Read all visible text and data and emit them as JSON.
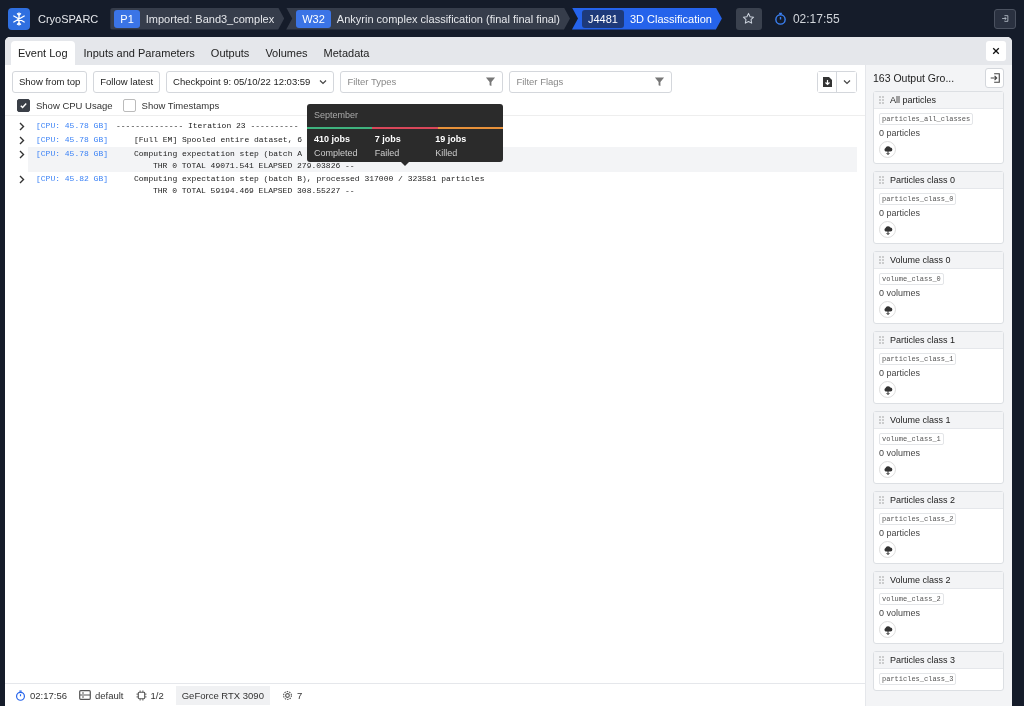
{
  "topbar": {
    "app_name": "CryoSPARC",
    "breadcrumbs": [
      {
        "badge": "P1",
        "label": "Imported: Band3_complex",
        "selected": false
      },
      {
        "badge": "W32",
        "label": "Ankyrin complex classification (final final final)",
        "selected": false
      },
      {
        "badge": "J4481",
        "label": "3D Classification",
        "selected": true
      }
    ],
    "timer": "02:17:55"
  },
  "tabs": [
    {
      "label": "Event Log",
      "selected": true
    },
    {
      "label": "Inputs and Parameters",
      "selected": false
    },
    {
      "label": "Outputs",
      "selected": false
    },
    {
      "label": "Volumes",
      "selected": false
    },
    {
      "label": "Metadata",
      "selected": false
    }
  ],
  "toolbar": {
    "buttons": [
      "Show from top",
      "Follow latest"
    ],
    "checkpoint": "Checkpoint 9: 05/10/22 12:03:59",
    "filter_types": {
      "placeholder": "Filter Types"
    },
    "filter_flags": {
      "placeholder": "Filter Flags"
    }
  },
  "options": [
    {
      "label": "Show CPU Usage",
      "checked": true
    },
    {
      "label": "Show Timestamps",
      "checked": false
    }
  ],
  "log": [
    {
      "kind": "header",
      "cpu": "[CPU: 45.78 GB]",
      "text": "-------------- Iteration 23 ----------",
      "highlighted": false
    },
    {
      "kind": "message",
      "cpu": "[CPU: 45.78 GB]",
      "text": "[Full EM] Spooled entire dataset, 6",
      "highlighted": false
    },
    {
      "kind": "message",
      "cpu": "[CPU: 45.78 GB]",
      "text": "Computing expectation step (batch A",
      "detail": "THR 0 TOTAL 49071.541 ELAPSED 279.03826 --",
      "highlighted": true
    },
    {
      "kind": "message",
      "cpu": "[CPU: 45.82 GB]",
      "text": "Computing expectation step (batch B), processed 317000 / 323581 particles",
      "detail": "THR 0 TOTAL 59194.469 ELAPSED 308.55227 --",
      "highlighted": false
    }
  ],
  "tooltip": {
    "title": "September",
    "stats": [
      {
        "value": "410 jobs",
        "label": "Completed",
        "color": "#3fb37f"
      },
      {
        "value": "7 jobs",
        "label": "Failed",
        "color": "#d9475a"
      },
      {
        "value": "19 jobs",
        "label": "Killed",
        "color": "#e8913a"
      }
    ]
  },
  "sidebar": {
    "title": "163 Output Gro...",
    "groups": [
      {
        "title": "All particles",
        "code": "particles_all_classes",
        "count": "0 particles"
      },
      {
        "title": "Particles class 0",
        "code": "particles_class_0",
        "count": "0 particles"
      },
      {
        "title": "Volume class 0",
        "code": "volume_class_0",
        "count": "0 volumes"
      },
      {
        "title": "Particles class 1",
        "code": "particles_class_1",
        "count": "0 particles"
      },
      {
        "title": "Volume class 1",
        "code": "volume_class_1",
        "count": "0 volumes"
      },
      {
        "title": "Particles class 2",
        "code": "particles_class_2",
        "count": "0 particles"
      },
      {
        "title": "Volume class 2",
        "code": "volume_class_2",
        "count": "0 volumes"
      },
      {
        "title": "Particles class 3",
        "code": "particles_class_3"
      }
    ]
  },
  "status_bar": {
    "timer": "02:17:56",
    "lane": "default",
    "gpus": "1/2",
    "gpu_name": "GeForce RTX 3090",
    "threads": "7"
  }
}
